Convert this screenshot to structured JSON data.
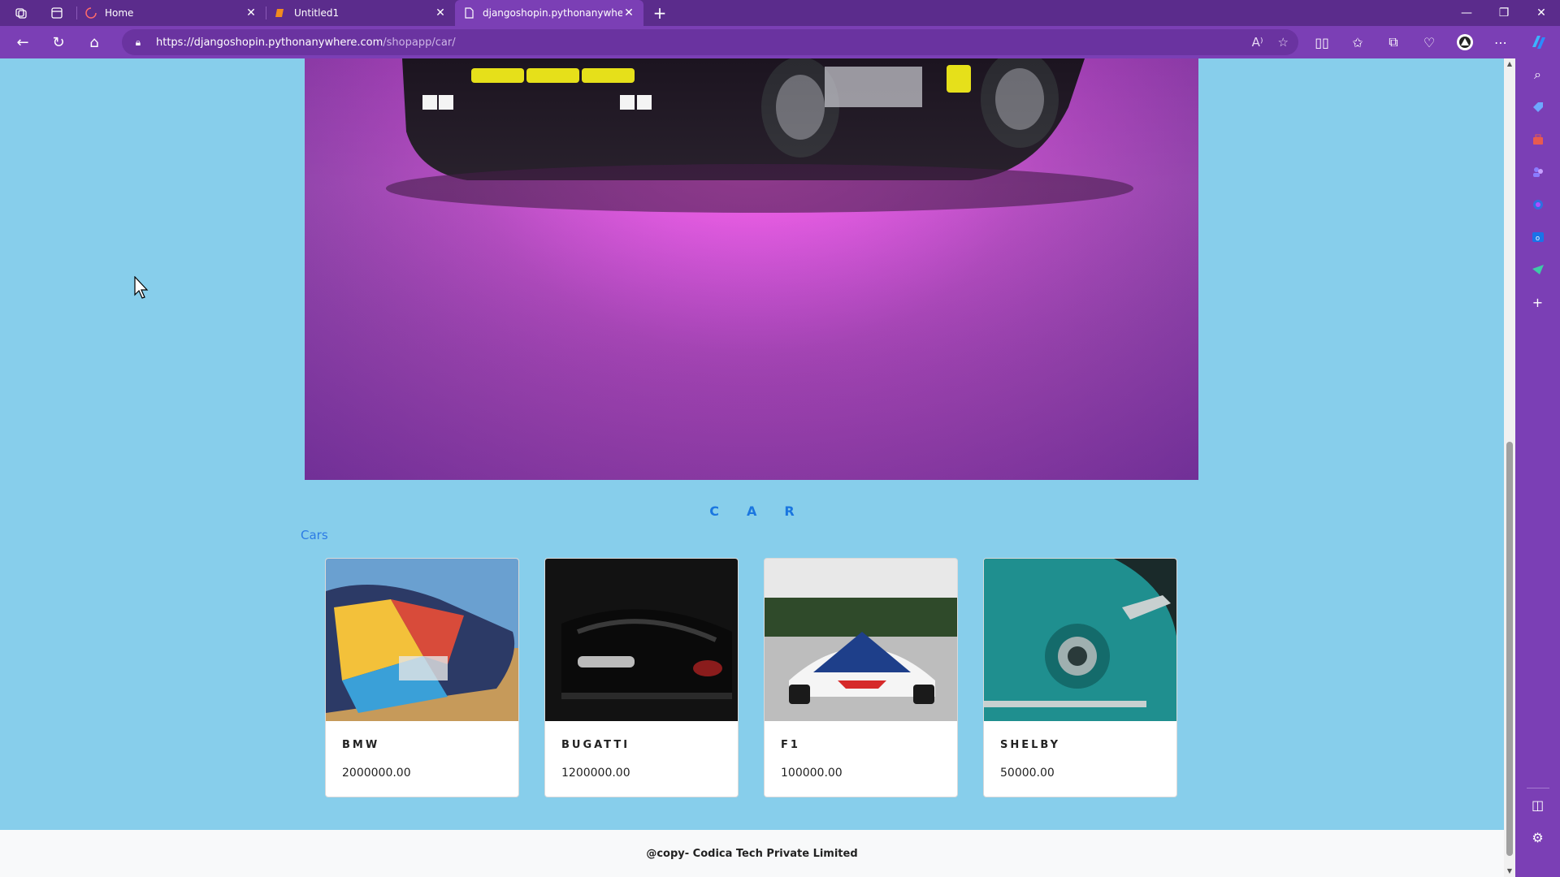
{
  "browser": {
    "tabs": [
      {
        "title": "Home",
        "active": false
      },
      {
        "title": "Untitled1",
        "active": false
      },
      {
        "title": "djangoshopin.pythonanywhere.c",
        "active": true
      }
    ],
    "url_host": "https://djangoshopin.pythonanywhere.com",
    "url_path": "/shopapp/car/",
    "accent_color": "#7b3fb5"
  },
  "page": {
    "section_title": "CAR",
    "category_link": "Cars",
    "products": [
      {
        "name": "BMW",
        "price": "2000000.00"
      },
      {
        "name": "BUGATTI",
        "price": "1200000.00"
      },
      {
        "name": "F1",
        "price": "100000.00"
      },
      {
        "name": "SHELBY",
        "price": "50000.00"
      }
    ],
    "footer_text": "@copy- Codica Tech Private Limited",
    "background_color": "#87ceeb",
    "link_color": "#2c7be5"
  }
}
